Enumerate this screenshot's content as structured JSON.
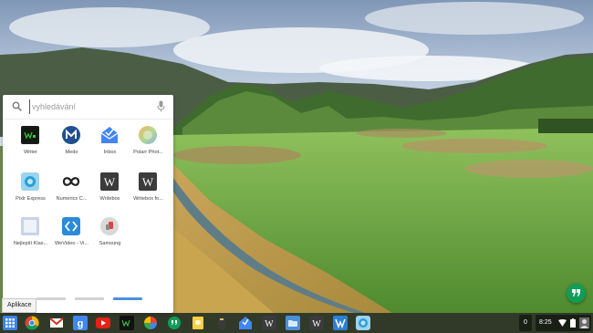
{
  "launcher": {
    "search_placeholder": "vyhledávání",
    "apps": [
      {
        "name": "Writer",
        "icon": "writer-icon"
      },
      {
        "name": "Medo",
        "icon": "medo-icon"
      },
      {
        "name": "Inbox",
        "icon": "inbox-icon"
      },
      {
        "name": "Polarr Phot...",
        "icon": "polarr-icon"
      },
      {
        "name": "Pixlr Express",
        "icon": "pixlr-icon"
      },
      {
        "name": "Numerics C...",
        "icon": "numerics-icon"
      },
      {
        "name": "Writebox",
        "icon": "writebox-icon"
      },
      {
        "name": "Writebox fo...",
        "icon": "writebox-icon"
      },
      {
        "name": "Nejlepší Klas...",
        "icon": "klasika-icon"
      },
      {
        "name": "WeVideo - Vi...",
        "icon": "wevideo-icon"
      },
      {
        "name": "Samsung",
        "icon": "samsung-icon"
      }
    ],
    "pages": 3,
    "active_page": 3
  },
  "tooltip": "Aplikace",
  "shelf": {
    "apps": [
      "app-launcher-icon",
      "chrome-icon",
      "gmail-icon",
      "google-search-icon",
      "youtube-icon",
      "writer-icon",
      "photos-icon",
      "hangouts-icon",
      "keep-icon",
      "files-icon",
      "inbox-icon",
      "writebox-icon",
      "files-folder-icon",
      "writebox-icon",
      "kanban-icon",
      "pixlr-icon"
    ],
    "notification_count": "0",
    "time": "8:25"
  },
  "colors": {
    "shelf": "#1a1a1a",
    "hangouts": "#0f9d58",
    "pager_active": "#4a90e2"
  }
}
